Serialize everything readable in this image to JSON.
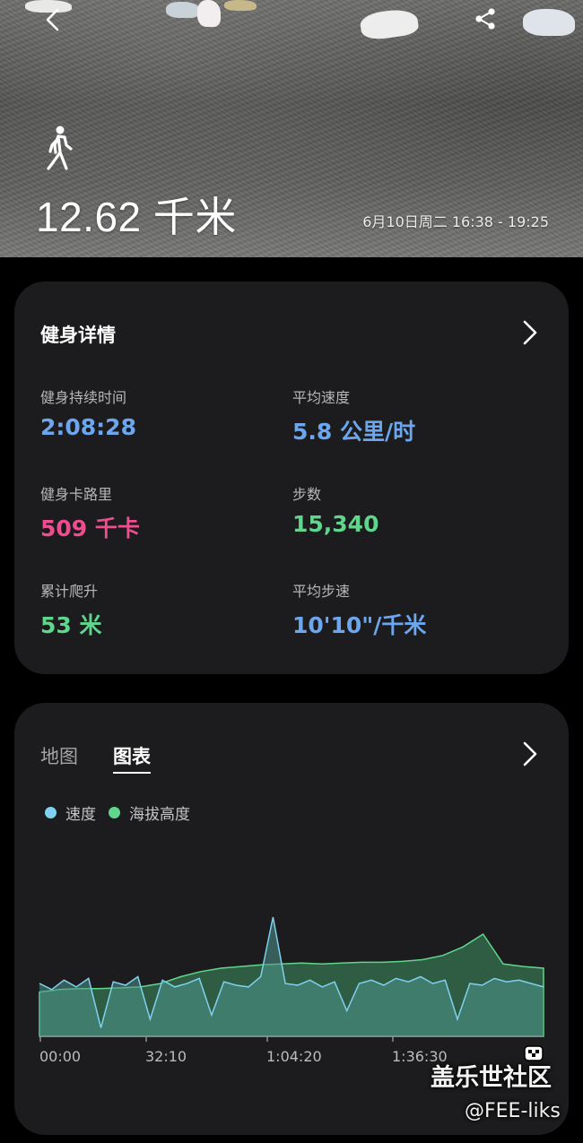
{
  "header": {
    "distance": "12.62 千米",
    "date_range": "6月10日周二 16:38 - 19:25",
    "back_icon": "chevron-left-icon",
    "share_icon": "share-icon",
    "activity_icon": "walking-icon"
  },
  "details_card": {
    "title": "健身详情",
    "metrics": [
      {
        "label": "健身持续时间",
        "value": "2:08:28",
        "color": "#6ba6ee"
      },
      {
        "label": "平均速度",
        "value": "5.8 公里/时",
        "color": "#6ba6ee"
      },
      {
        "label": "健身卡路里",
        "value": "509 千卡",
        "color": "#ee4d8f"
      },
      {
        "label": "步数",
        "value": "15,340",
        "color": "#5fd68b"
      },
      {
        "label": "累计爬升",
        "value": "53 米",
        "color": "#5fd68b"
      },
      {
        "label": "平均步速",
        "value": "10'10\"/千米",
        "color": "#6ba6ee"
      }
    ]
  },
  "chart_card": {
    "tabs": [
      {
        "label": "地图",
        "active": false
      },
      {
        "label": "图表",
        "active": true
      }
    ],
    "legend": [
      {
        "label": "速度",
        "color": "#7fd0f0"
      },
      {
        "label": "海拔高度",
        "color": "#5fd68b"
      }
    ]
  },
  "chart_data": {
    "type": "area",
    "x_ticks": [
      "00:00",
      "32:10",
      "1:04:20",
      "1:36:30"
    ],
    "series": [
      {
        "name": "海拔高度",
        "color": "#5fd68b",
        "values": [
          0.52,
          0.55,
          0.56,
          0.56,
          0.57,
          0.58,
          0.62,
          0.7,
          0.76,
          0.8,
          0.82,
          0.84,
          0.85,
          0.86,
          0.85,
          0.86,
          0.87,
          0.87,
          0.88,
          0.9,
          0.95,
          1.05,
          1.2,
          0.85,
          0.82,
          0.8
        ]
      },
      {
        "name": "速度",
        "color": "#7fd0f0",
        "values": [
          0.62,
          0.55,
          0.66,
          0.58,
          0.68,
          0.1,
          0.64,
          0.6,
          0.7,
          0.2,
          0.66,
          0.58,
          0.62,
          0.68,
          0.25,
          0.64,
          0.6,
          0.58,
          0.7,
          1.4,
          0.62,
          0.6,
          0.66,
          0.58,
          0.64,
          0.3,
          0.62,
          0.66,
          0.6,
          0.68,
          0.64,
          0.7,
          0.62,
          0.66,
          0.2,
          0.62,
          0.6,
          0.68,
          0.64,
          0.66,
          0.62,
          0.58
        ]
      }
    ]
  },
  "watermark": {
    "site": "盖乐世社区",
    "user": "@FEE-liks",
    "logo_icon": "community-logo-icon"
  }
}
